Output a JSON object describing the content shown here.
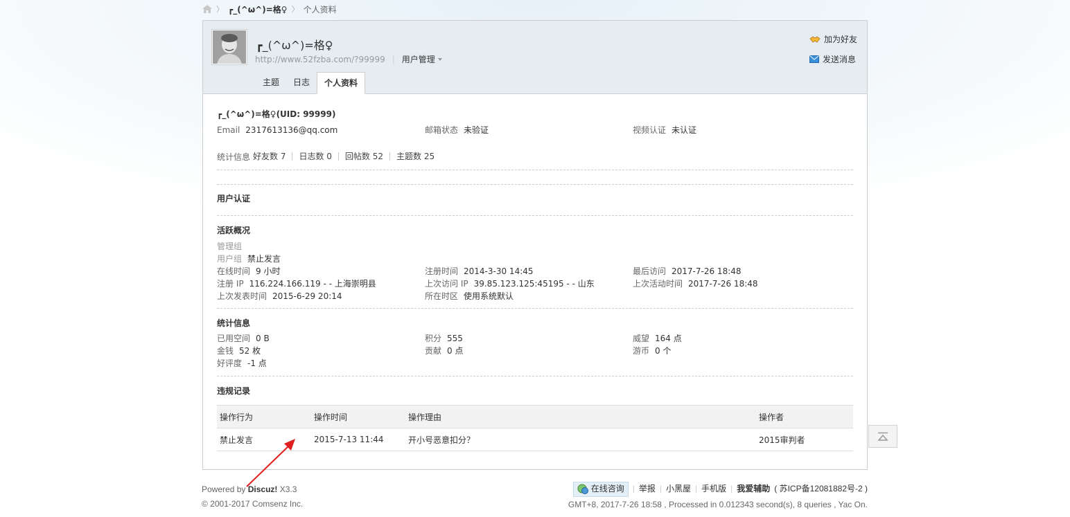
{
  "breadcrumb": {
    "user": "┏_(^ω^)=格♀",
    "page": "个人资料"
  },
  "header": {
    "username": "┏_(^ω^)=格♀",
    "url": "http://www.52fzba.com/?99999",
    "manage": "用户管理",
    "add_friend": "加为好友",
    "send_msg": "发送消息",
    "tabs": [
      "主题",
      "日志",
      "个人资料"
    ]
  },
  "profile": {
    "title": "┏_(^ω^)=格♀(UID: 99999)",
    "email_label": "Email",
    "email": "2317613136@qq.com",
    "mail_status_label": "邮箱状态",
    "mail_status": "未验证",
    "video_label": "视频认证",
    "video": "未认证",
    "stats_label": "统计信息",
    "stats": [
      "好友数 7",
      "日志数 0",
      "回帖数 52",
      "主题数 25"
    ]
  },
  "auth": {
    "title": "用户认证"
  },
  "activity": {
    "title": "活跃概况",
    "admin_group_label": "管理组",
    "user_group_label": "用户组",
    "user_group": "禁止发言",
    "online_label": "在线时间",
    "online": "9 小时",
    "reg_time_label": "注册时间",
    "reg_time": "2014-3-30 14:45",
    "last_visit_label": "最后访问",
    "last_visit": "2017-7-26 18:48",
    "reg_ip_label": "注册 IP",
    "reg_ip": "116.224.166.119 - - 上海崇明县",
    "last_ip_label": "上次访问 IP",
    "last_ip": "39.85.123.125:45195 - - 山东",
    "last_active_label": "上次活动时间",
    "last_active": "2017-7-26 18:48",
    "last_post_label": "上次发表时间",
    "last_post": "2015-6-29 20:14",
    "tz_label": "所在时区",
    "tz": "使用系统默认"
  },
  "statistics": {
    "title": "统计信息",
    "space_label": "已用空间",
    "space": "0 B",
    "credits_label": "积分",
    "credits": "555",
    "prestige_label": "威望",
    "prestige": "164 点",
    "money_label": "金钱",
    "money": "52 枚",
    "contrib_label": "贡献",
    "contrib": "0 点",
    "coins_label": "游币",
    "coins": "0 个",
    "rating_label": "好评度",
    "rating": "-1 点"
  },
  "violations": {
    "title": "违规记录",
    "headers": [
      "操作行为",
      "操作时间",
      "操作理由",
      "操作者"
    ],
    "rows": [
      [
        "禁止发言",
        "2015-7-13 11:44",
        "开小号恶意扣分？",
        "2015审判者"
      ]
    ]
  },
  "footer": {
    "powered_prefix": "Powered by",
    "powered_brand": "Discuz!",
    "version": "X3.3",
    "copyright": "© 2001-2017 Comsenz Inc.",
    "consult": "在线咨询",
    "links": [
      "举报",
      "小黑屋",
      "手机版"
    ],
    "site": "我爱辅助",
    "icp": "( 苏ICP备12081882号-2 )",
    "stats": "GMT+8, 2017-7-26 18:58 , Processed in 0.012343 second(s), 8 queries , Yac On."
  }
}
